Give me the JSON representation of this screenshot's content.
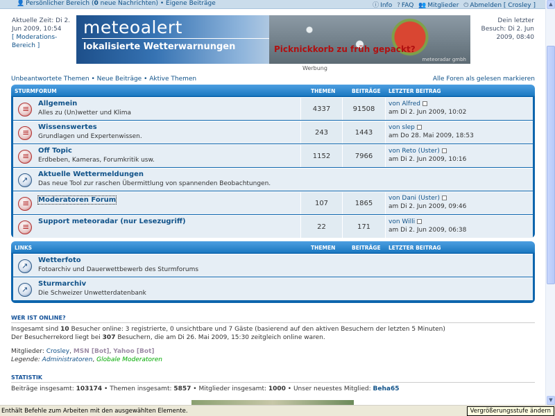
{
  "topnav": {
    "user_panel": "Persönlicher Bereich (",
    "new_msgs_count": "0",
    "new_msgs_suffix": " neue Nachrichten) • Eigene Beiträge",
    "info": "Info",
    "faq": "FAQ",
    "members": "Mitglieder",
    "logout": "Abmelden [ Crosley ]"
  },
  "header": {
    "current_time": "Aktuelle Zeit: Di 2. Jun 2009, 10:54",
    "mod_area": "[ Moderations-Bereich ]",
    "last_visit": "Dein letzter Besuch: Di 2. Jun 2009, 08:40",
    "banner_logo": "meteoalert",
    "banner_tagline": "lokalisierte Wetterwarnungen",
    "banner_ad": "Picknickkorb zu früh gepackt?",
    "banner_credit": "meteoradar gmbh",
    "ad_label": "Werbung"
  },
  "links": {
    "unanswered": "Unbeantwortete Themen",
    "new_posts": "Neue Beiträge",
    "active": "Aktive Themen",
    "mark_all": "Alle Foren als gelesen markieren"
  },
  "sturmforum": {
    "title": "Sturmforum",
    "col_topics": "Themen",
    "col_posts": "Beiträge",
    "col_last": "Letzter Beitrag",
    "rows": [
      {
        "title": "Allgemein",
        "desc": "Alles zu (Un)wetter und Klima",
        "topics": "4337",
        "posts": "91508",
        "last_by": "von Alfred",
        "last_date": "am Di 2. Jun 2009, 10:02"
      },
      {
        "title": "Wissenswertes",
        "desc": "Grundlagen und Expertenwissen.",
        "topics": "243",
        "posts": "1443",
        "last_by": "von slep",
        "last_date": "am Do 28. Mai 2009, 18:53"
      },
      {
        "title": "Off Topic",
        "desc": "Erdbeben, Kameras, Forumkritik usw.",
        "topics": "1152",
        "posts": "7966",
        "last_by": "von Reto (Uster)",
        "last_date": "am Di 2. Jun 2009, 10:16"
      },
      {
        "title": "Aktuelle Wettermeldungen",
        "desc": "Das neue Tool zur raschen Übermittlung von spannenden Beobachtungen."
      },
      {
        "title": "Moderatoren Forum",
        "desc": "",
        "topics": "107",
        "posts": "1865",
        "last_by": "von Dani (Uster)",
        "last_date": "am Di 2. Jun 2009, 09:46"
      },
      {
        "title": "Support meteoradar (nur Lesezugriff)",
        "desc": "",
        "topics": "22",
        "posts": "171",
        "last_by": "von Willi",
        "last_date": "am Di 2. Jun 2009, 06:38"
      }
    ]
  },
  "links_forum": {
    "title": "Links",
    "col_topics": "Themen",
    "col_posts": "Beiträge",
    "col_last": "Letzter Beitrag",
    "rows": [
      {
        "title": "Wetterfoto",
        "desc": "Fotoarchiv und Dauerwettbewerb des Sturmforums"
      },
      {
        "title": "Sturmarchiv",
        "desc": "Die Schweizer Unwetterdatenbank"
      }
    ]
  },
  "online": {
    "title": "Wer ist online?",
    "line1_a": "Insgesamt sind ",
    "line1_count": "10",
    "line1_b": " Besucher online: 3 registrierte, 0 unsichtbare und 7 Gäste (basierend auf den aktiven Besuchern der letzten 5 Minuten)",
    "line2_a": "Der Besucherrekord liegt bei ",
    "line2_count": "307",
    "line2_b": " Besuchern, die am Di 26. Mai 2009, 15:30 zeitgleich online waren.",
    "members_label": "Mitglieder: ",
    "member1": "Crosley",
    "member2": "MSN [Bot]",
    "member3": "Yahoo [Bot]",
    "legend_label": "Legende: ",
    "legend_admin": "Administratoren",
    "legend_mod": "Globale Moderatoren"
  },
  "stats": {
    "title": "Statistik",
    "posts_label": "Beiträge insgesamt: ",
    "posts": "103174",
    "topics_label": " • Themen insgesamt: ",
    "topics": "5857",
    "members_label": " • Mitglieder insgesamt: ",
    "members": "1000",
    "newest_label": " • Unser neuestes Mitglied: ",
    "newest": "Beha65"
  },
  "statusbar": {
    "message": "Enthält Befehle zum Arbeiten mit den ausgewählten Elemente.",
    "zoom": "Vergrößerungsstufe ändern"
  },
  "colors": {
    "accent": "#105289",
    "header_blue": "#0d65ad",
    "row_bg": "#e6eef5",
    "global_mod": "#00aa00"
  }
}
